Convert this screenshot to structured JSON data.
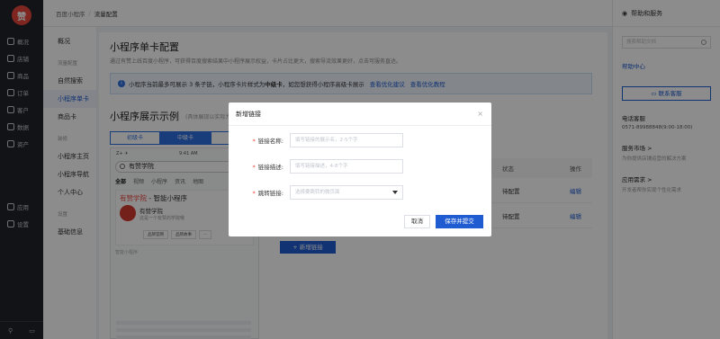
{
  "nav": {
    "logo": "赞",
    "items": [
      "概况",
      "店铺",
      "商品",
      "订单",
      "客户",
      "数据",
      "资产"
    ],
    "apps": [
      "应用",
      "设置"
    ]
  },
  "topbar": {
    "crumb1": "百度小程序",
    "sep": "/",
    "crumb2": "流量配置"
  },
  "side2": {
    "items_top": [
      "概况"
    ],
    "group1": "流量配置",
    "items_g1": [
      "自然搜索",
      "小程序单卡",
      "商品卡"
    ],
    "group2": "装修",
    "items_g2": [
      "小程序主页",
      "小程序导航",
      "个人中心"
    ],
    "group3": "设置",
    "items_g3": [
      "基础信息"
    ]
  },
  "main": {
    "title": "小程序单卡配置",
    "desc": "通过有赞上线百度小程序，可获得百度搜索结果中小程序展示权益，卡片占比更大，搜索导流效果更好，点击可服务直达。",
    "info": "小程序当前最多可展示 3 条子链，小程序卡片样式为",
    "info_bold": "中级卡",
    "info_tail": "，如您想获得小程序高级卡展示",
    "info_link1": "查看优化建议",
    "info_link2": "查看优化教程",
    "section_title": "小程序展示示例",
    "section_note": "(具体展现以实际为准)",
    "tabs": [
      "初级卡",
      "中级卡",
      "高"
    ],
    "phone": {
      "carrier": "Z+ ✈",
      "time": "9:41 AM",
      "battery": "▭",
      "search": "有赞学院",
      "tabs": [
        "全部",
        "视频",
        "小程序",
        "资讯",
        "地图"
      ],
      "card_title_red": "有赞学院",
      "card_title_rest": " - 智能小程序",
      "card_name": "有赞学院",
      "card_sub": "这是一个有赞的学院哦",
      "card_btns": [
        "品牌官网",
        "品牌故事",
        "..."
      ],
      "foot": "智能小程序"
    },
    "table": {
      "headers": [
        "",
        "状态",
        "操作"
      ],
      "rows": [
        {
          "status": "待配置",
          "action": "编辑"
        },
        {
          "status": "待配置",
          "action": "编辑"
        }
      ]
    },
    "add_btn": "+ 新增链接"
  },
  "right": {
    "title": "帮助和服务",
    "search_placeholder": "搜索帮助文档",
    "help_center": "帮助中心",
    "contact": "联系客服",
    "phone_title": "电话客服",
    "phone": "0571-89988848(9:00-18:00)",
    "service_title": "服务市场 >",
    "service_sub": "为你提供店铺运营的解决方案",
    "app_title": "应用需求 >",
    "app_sub": "开发者帮你实现个性化需求"
  },
  "modal": {
    "title": "新增链接",
    "close": "×",
    "name_label": "链接名称:",
    "name_placeholder": "填写链接的展示名，2-5个字",
    "desc_label": "链接描述:",
    "desc_placeholder": "填写链接描述，4-8个字",
    "jump_label": "跳转链接:",
    "jump_placeholder": "选择要跳转的微页面",
    "required": "*",
    "cancel": "取消",
    "submit": "保存并提交"
  }
}
